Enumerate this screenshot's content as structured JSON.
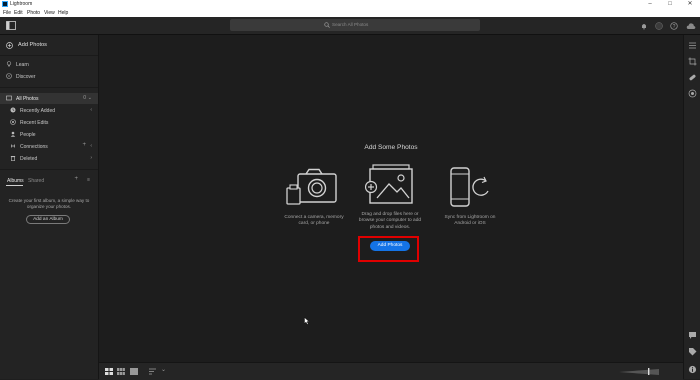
{
  "window": {
    "title": "Lightroom"
  },
  "menu": [
    "File",
    "Edit",
    "Photo",
    "View",
    "Help"
  ],
  "search": {
    "placeholder": "Search All Photos"
  },
  "sidebar": {
    "add_photos": "Add Photos",
    "learn": "Learn",
    "discover": "Discover",
    "all_photos": "All Photos",
    "all_photos_count": "0",
    "items": [
      {
        "label": "Recently Added",
        "icon": "clock-icon"
      },
      {
        "label": "Recent Edits",
        "icon": "edit-history-icon"
      },
      {
        "label": "People",
        "icon": "person-icon"
      },
      {
        "label": "Connections",
        "icon": "connections-icon"
      },
      {
        "label": "Deleted",
        "icon": "trash-icon"
      }
    ],
    "tabs": [
      "Albums",
      "Shared"
    ],
    "albums_empty": "Create your first album, a simple way to organize your photos.",
    "add_album": "Add an Album"
  },
  "main": {
    "headline": "Add Some Photos",
    "options": [
      {
        "caption": "Connect a camera, memory card, or phone",
        "icon": "camera-icon"
      },
      {
        "caption": "Drag and drop files here or browse your computer to add photos and videos.",
        "icon": "add-image-icon"
      },
      {
        "caption": "Sync from Lightroom on Android or iOS",
        "icon": "phone-sync-icon"
      }
    ],
    "add_button": "Add Photos"
  },
  "colors": {
    "accent": "#1473e6",
    "highlight": "#e00000",
    "background": "#1d1d1d"
  }
}
